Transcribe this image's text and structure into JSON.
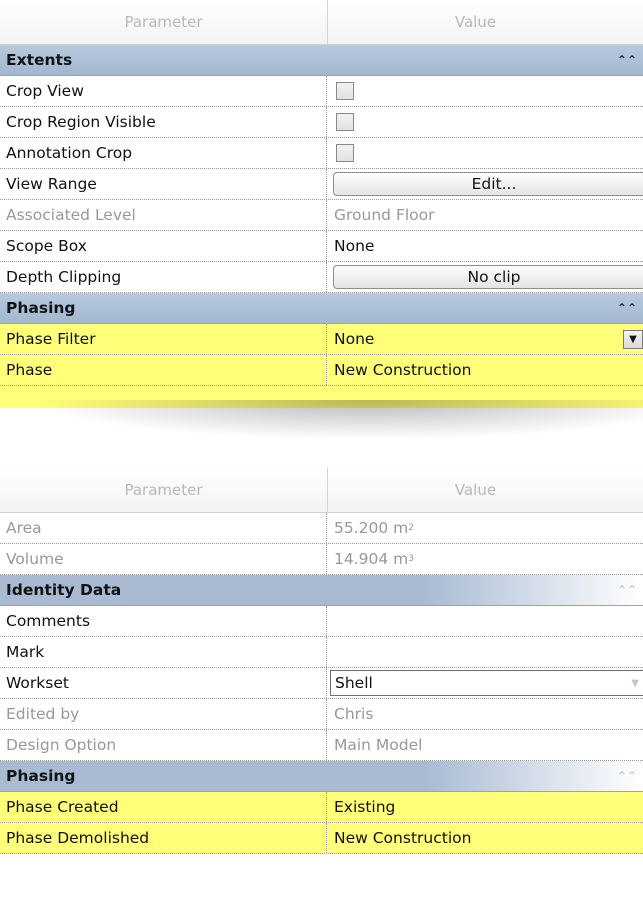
{
  "panel1": {
    "header": {
      "param": "Parameter",
      "value": "Value"
    },
    "extents": {
      "title": "Extents",
      "crop_view": "Crop View",
      "crop_region_visible": "Crop Region Visible",
      "annotation_crop": "Annotation Crop",
      "view_range": "View Range",
      "view_range_button": "Edit...",
      "associated_level": "Associated Level",
      "associated_level_value": "Ground Floor",
      "scope_box": "Scope Box",
      "scope_box_value": "None",
      "depth_clipping": "Depth Clipping",
      "depth_clipping_button": "No clip"
    },
    "phasing": {
      "title": "Phasing",
      "phase_filter": "Phase Filter",
      "phase_filter_value": "None",
      "phase": "Phase",
      "phase_value": "New Construction"
    }
  },
  "panel2": {
    "header": {
      "param": "Parameter",
      "value": "Value"
    },
    "area": {
      "label": "Area",
      "value": "55.200 m",
      "exp": "2"
    },
    "volume": {
      "label": "Volume",
      "value": "14.904 m",
      "exp": "3"
    },
    "identity": {
      "title": "Identity Data",
      "comments": "Comments",
      "mark": "Mark",
      "workset": "Workset",
      "workset_value": "Shell",
      "edited_by": "Edited by",
      "edited_by_value": "Chris",
      "design_option": "Design Option",
      "design_option_value": "Main Model"
    },
    "phasing": {
      "title": "Phasing",
      "phase_created": "Phase Created",
      "phase_created_value": "Existing",
      "phase_demolished": "Phase Demolished",
      "phase_demolished_value": "New Construction"
    }
  },
  "icons": {
    "collapse": "double-chevron-up-icon",
    "dropdown": "dropdown-arrow-icon"
  }
}
